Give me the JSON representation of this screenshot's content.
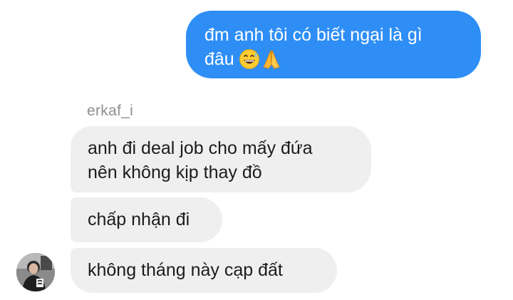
{
  "messages": {
    "outgoing": {
      "line1": "đm anh tôi có biết ngại là gì",
      "line2": "đâu",
      "emojis": [
        "grinning-sweat-emoji",
        "folded-hands-emoji"
      ],
      "bubble_color": "#2e8ef6"
    },
    "sender_name": "erkaf_i",
    "incoming": [
      {
        "line1": "anh đi deal job cho mấy đứa",
        "line2": "nên không kịp thay đồ"
      },
      {
        "line1": "chấp nhận đi"
      },
      {
        "line1": "không tháng này cạp đất"
      }
    ],
    "incoming_bubble_color": "#efeff0"
  }
}
